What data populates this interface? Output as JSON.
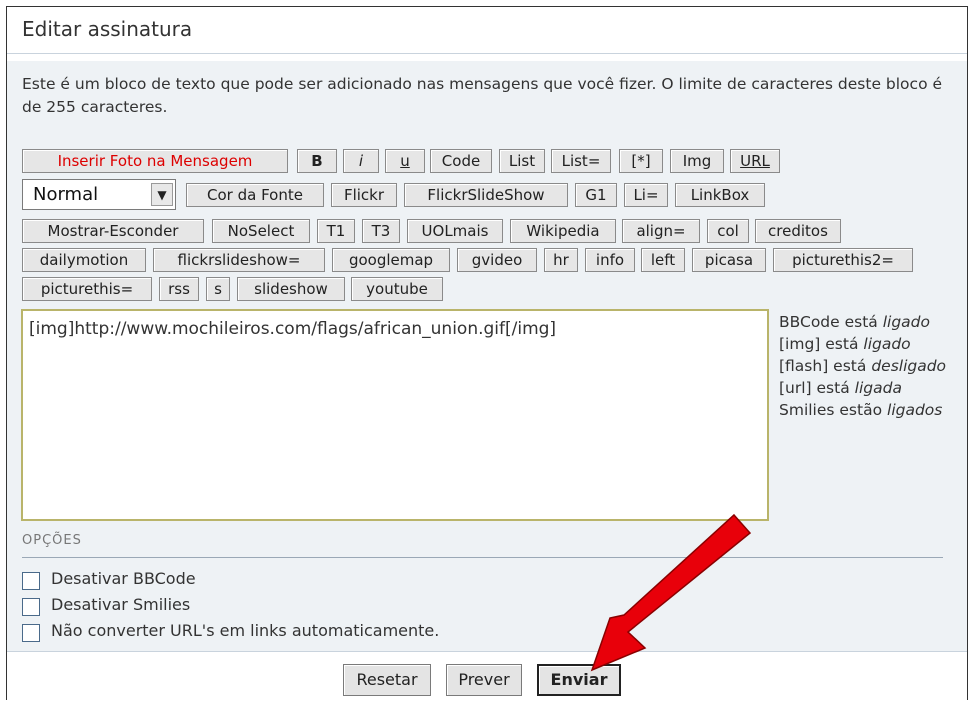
{
  "window": {
    "title": "Editar assinatura"
  },
  "description": "Este é um bloco de texto que pode ser adicionado nas mensagens que você fizer. O limite de caracteres deste bloco é de 255 caracteres.",
  "toolbar": {
    "row1": [
      "Inserir Foto na Mensagem",
      "B",
      "i",
      "u",
      "Code",
      "List",
      "List=",
      "[*]",
      "Img",
      "URL"
    ],
    "font_size_select": "Normal",
    "row2": [
      "Cor da Fonte",
      "Flickr",
      "FlickrSlideShow",
      "G1",
      "Li=",
      "LinkBox"
    ],
    "row3": [
      "Mostrar-Esconder",
      "NoSelect",
      "T1",
      "T3",
      "UOLmais",
      "Wikipedia",
      "align=",
      "col",
      "creditos"
    ],
    "row4": [
      "dailymotion",
      "flickrslideshow=",
      "googlemap",
      "gvideo",
      "hr",
      "info",
      "left",
      "picasa",
      "picturethis2="
    ],
    "row5": [
      "picturethis=",
      "rss",
      "s",
      "slideshow",
      "youtube"
    ]
  },
  "editor": {
    "value": "[img]http://www.mochileiros.com/flags/african_union.gif[/img]"
  },
  "status": {
    "bbcode_label": "BBCode está",
    "bbcode_state": "ligado",
    "img_label": "[img] está",
    "img_state": "ligado",
    "flash_label": "[flash] está",
    "flash_state": "desligado",
    "url_label": "[url] está",
    "url_state": "ligada",
    "smilies_label": "Smilies estão",
    "smilies_state": "ligados"
  },
  "options": {
    "heading": "OPÇÕES",
    "items": [
      "Desativar BBCode",
      "Desativar Smilies",
      "Não converter URL's em links automaticamente."
    ]
  },
  "footer": {
    "reset": "Resetar",
    "preview": "Prever",
    "submit": "Enviar"
  },
  "annotation_color": "#e8000a"
}
